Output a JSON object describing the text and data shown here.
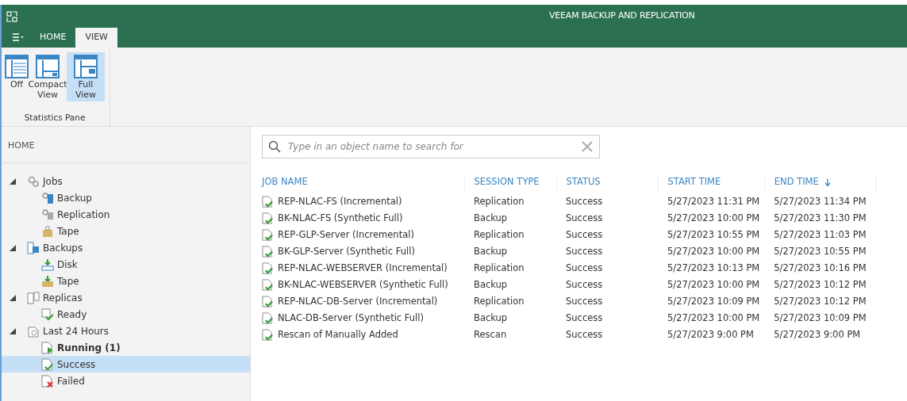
{
  "window": {
    "title": "VEEAM BACKUP AND REPLICATION"
  },
  "tabs": [
    {
      "label": "HOME",
      "selected": false
    },
    {
      "label": "VIEW",
      "selected": true
    }
  ],
  "ribbon": {
    "buttons": [
      {
        "label": "Off",
        "selected": false
      },
      {
        "label": "Compact View",
        "selected": false
      },
      {
        "label": "Full View",
        "selected": true
      }
    ],
    "group_label": "Statistics Pane"
  },
  "sidebar": {
    "title": "HOME",
    "items": [
      {
        "label": "Jobs",
        "expanded": true,
        "selected": false,
        "bold": false,
        "children": [
          {
            "label": "Backup",
            "selected": false,
            "bold": false
          },
          {
            "label": "Replication",
            "selected": false,
            "bold": false
          },
          {
            "label": "Tape",
            "selected": false,
            "bold": false
          }
        ]
      },
      {
        "label": "Backups",
        "expanded": true,
        "selected": false,
        "bold": false,
        "children": [
          {
            "label": "Disk",
            "selected": false,
            "bold": false
          },
          {
            "label": "Tape",
            "selected": false,
            "bold": false
          }
        ]
      },
      {
        "label": "Replicas",
        "expanded": true,
        "selected": false,
        "bold": false,
        "children": [
          {
            "label": "Ready",
            "selected": false,
            "bold": false
          }
        ]
      },
      {
        "label": "Last 24 Hours",
        "expanded": true,
        "selected": false,
        "bold": false,
        "children": [
          {
            "label": "Running (1)",
            "selected": false,
            "bold": true
          },
          {
            "label": "Success",
            "selected": true,
            "bold": false
          },
          {
            "label": "Failed",
            "selected": false,
            "bold": false
          }
        ]
      }
    ]
  },
  "search": {
    "placeholder": "Type in an object name to search for"
  },
  "table": {
    "columns": [
      {
        "label": "JOB NAME",
        "sorted": false
      },
      {
        "label": "SESSION TYPE",
        "sorted": false
      },
      {
        "label": "STATUS",
        "sorted": false
      },
      {
        "label": "START TIME",
        "sorted": false
      },
      {
        "label": "END TIME",
        "sorted": true
      }
    ],
    "rows": [
      [
        "REP-NLAC-FS (Incremental)",
        "Replication",
        "Success",
        "5/27/2023 11:31 PM",
        "5/27/2023 11:34 PM"
      ],
      [
        "BK-NLAC-FS (Synthetic Full)",
        "Backup",
        "Success",
        "5/27/2023 10:00 PM",
        "5/27/2023 11:30 PM"
      ],
      [
        "REP-GLP-Server (Incremental)",
        "Replication",
        "Success",
        "5/27/2023 10:55 PM",
        "5/27/2023 11:03 PM"
      ],
      [
        "BK-GLP-Server (Synthetic Full)",
        "Backup",
        "Success",
        "5/27/2023 10:00 PM",
        "5/27/2023 10:55 PM"
      ],
      [
        "REP-NLAC-WEBSERVER (Incremental)",
        "Replication",
        "Success",
        "5/27/2023 10:13 PM",
        "5/27/2023 10:16 PM"
      ],
      [
        "BK-NLAC-WEBSERVER (Synthetic Full)",
        "Backup",
        "Success",
        "5/27/2023 10:00 PM",
        "5/27/2023 10:12 PM"
      ],
      [
        "REP-NLAC-DB-Server (Incremental)",
        "Replication",
        "Success",
        "5/27/2023 10:09 PM",
        "5/27/2023 10:12 PM"
      ],
      [
        "NLAC-DB-Server (Synthetic Full)",
        "Backup",
        "Success",
        "5/27/2023 10:00 PM",
        "5/27/2023 10:09 PM"
      ],
      [
        "Rescan of Manually Added",
        "Rescan",
        "Success",
        "5/27/2023 9:00 PM",
        "5/27/2023 9:00 PM"
      ]
    ]
  }
}
